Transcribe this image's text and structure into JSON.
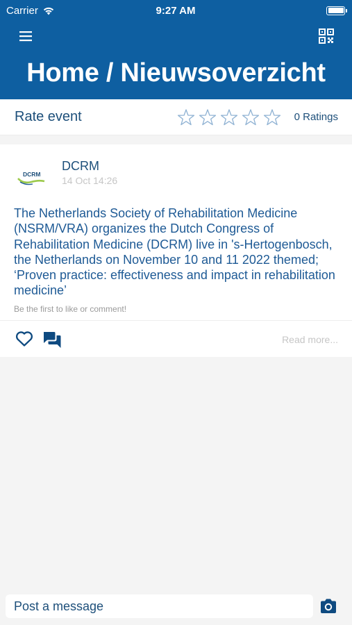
{
  "status_bar": {
    "carrier": "Carrier",
    "time": "9:27 AM"
  },
  "header": {
    "title": "Home / Nieuwsoverzicht",
    "background_color": "#0e5fa1",
    "menu_icon": "hamburger-menu-icon",
    "qr_icon": "qr-code-icon"
  },
  "rating": {
    "label": "Rate event",
    "stars_total": 5,
    "stars_filled": 0,
    "count_text": "0 Ratings"
  },
  "post": {
    "author": "DCRM",
    "logo_text": "DCRM",
    "date": "14 Oct 14:26",
    "body": "The Netherlands Society of Rehabilitation Medicine (NSRM/VRA) organizes the Dutch Congress of Rehabilitation Medicine (DCRM) live in 's-Hertogenbosch, the Netherlands on November 10 and 11 2022 themed; ‘Proven practice: effectiveness and impact in rehabilitation medicine’",
    "like_hint": "Be the first to like or comment!",
    "read_more": "Read more..."
  },
  "composer": {
    "placeholder": "Post a message",
    "camera_icon": "camera-icon"
  },
  "colors": {
    "accent": "#0e5fa1",
    "text_primary": "#1d4f7a",
    "text_muted": "#c6c6c6",
    "background": "#f4f4f4"
  }
}
